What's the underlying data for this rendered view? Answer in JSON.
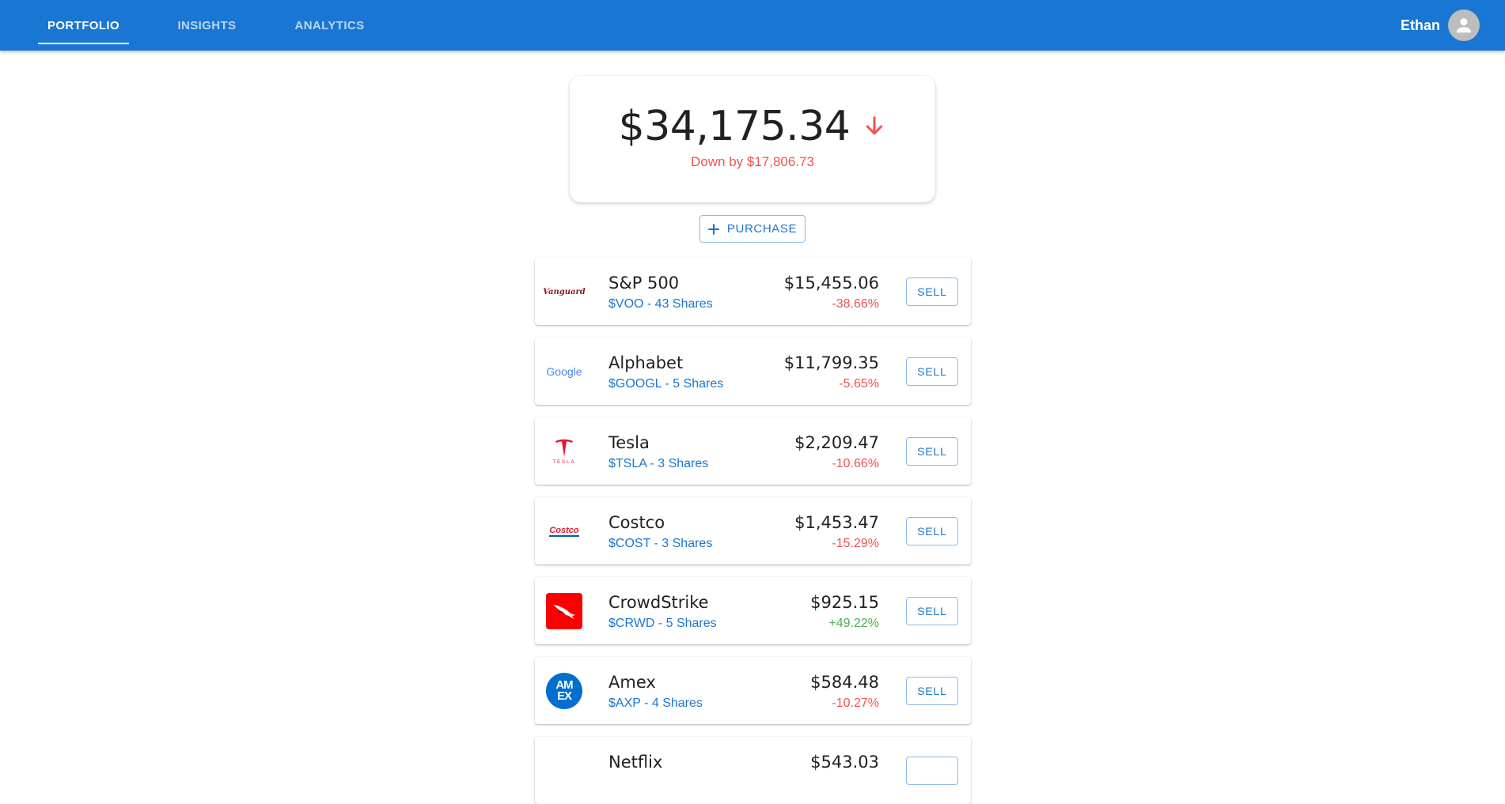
{
  "nav": {
    "tabs": [
      {
        "label": "PORTFOLIO",
        "active": true
      },
      {
        "label": "INSIGHTS",
        "active": false
      },
      {
        "label": "ANALYTICS",
        "active": false
      }
    ],
    "user_name": "Ethan"
  },
  "summary": {
    "total_value": "$34,175.34",
    "trend_icon": "arrow-down-icon",
    "change_text": "Down by $17,806.73"
  },
  "purchase_label": "PURCHASE",
  "holdings": [
    {
      "name": "S&P 500",
      "ticker_line": "$VOO - 43 Shares",
      "value": "$15,455.06",
      "change": "-38.66%",
      "direction": "down",
      "logo": "vanguard-logo",
      "logo_text": "Vanguard",
      "sell_label": "SELL"
    },
    {
      "name": "Alphabet",
      "ticker_line": "$GOOGL - 5 Shares",
      "value": "$11,799.35",
      "change": "-5.65%",
      "direction": "down",
      "logo": "google-logo",
      "logo_text": "Google",
      "sell_label": "SELL"
    },
    {
      "name": "Tesla",
      "ticker_line": "$TSLA - 3 Shares",
      "value": "$2,209.47",
      "change": "-10.66%",
      "direction": "down",
      "logo": "tesla-logo",
      "logo_text": "TESLA",
      "sell_label": "SELL"
    },
    {
      "name": "Costco",
      "ticker_line": "$COST - 3 Shares",
      "value": "$1,453.47",
      "change": "-15.29%",
      "direction": "down",
      "logo": "costco-logo",
      "logo_text": "Costco",
      "sell_label": "SELL"
    },
    {
      "name": "CrowdStrike",
      "ticker_line": "$CRWD - 5 Shares",
      "value": "$925.15",
      "change": "+49.22%",
      "direction": "up",
      "logo": "crowdstrike-logo",
      "logo_text": "",
      "sell_label": "SELL"
    },
    {
      "name": "Amex",
      "ticker_line": "$AXP - 4 Shares",
      "value": "$584.48",
      "change": "-10.27%",
      "direction": "down",
      "logo": "amex-logo",
      "logo_text": "AM EX",
      "sell_label": "SELL"
    },
    {
      "name": "Netflix",
      "ticker_line": "",
      "value": "$543.03",
      "change": "",
      "direction": "down",
      "logo": "netflix-logo",
      "logo_text": "",
      "sell_label": ""
    }
  ],
  "colors": {
    "primary": "#1976d2",
    "negative": "#ef5350",
    "positive": "#4caf50"
  }
}
